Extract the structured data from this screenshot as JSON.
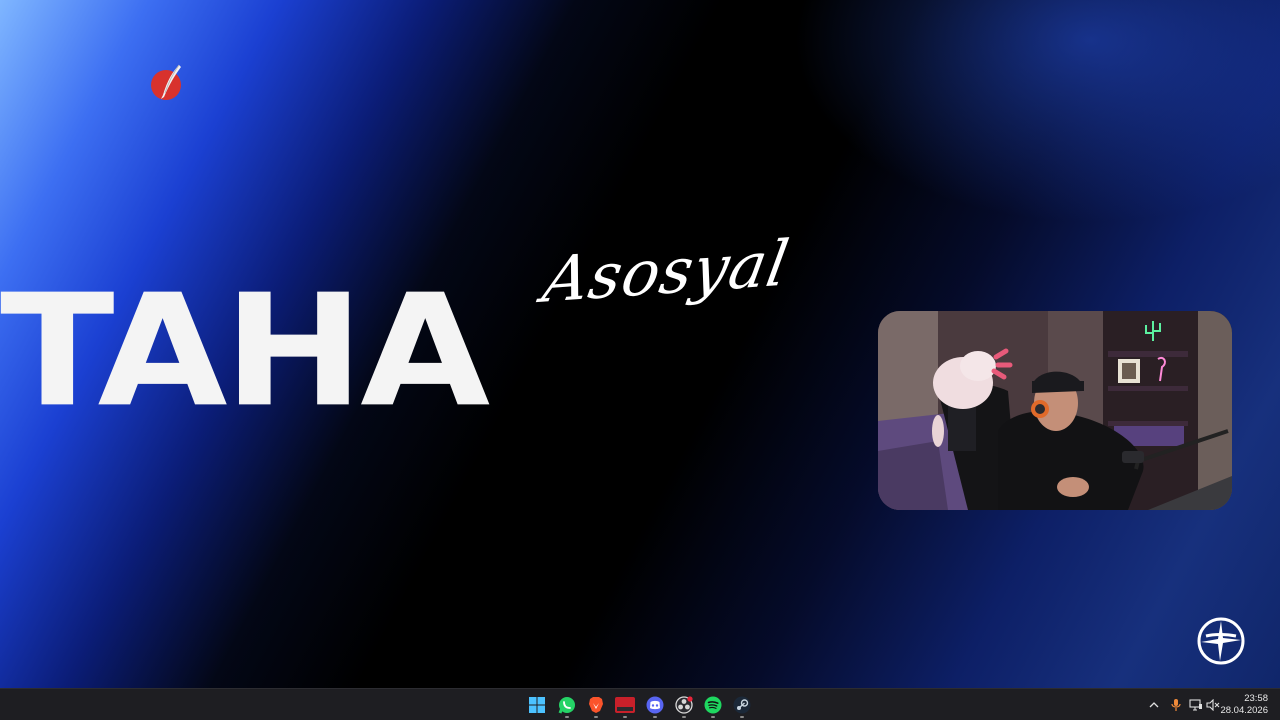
{
  "wallpaper": {
    "script_word": "Asosyal",
    "main_word": "TAHA",
    "accent_colors": [
      "#1b40d2",
      "#7fb6ff",
      "#000000"
    ]
  },
  "desktop": {
    "app_icon": "red-quill-app-icon",
    "corner_logo": "white-cross-circle-logo-icon"
  },
  "webcam": {
    "description_icon": "webcam-feed"
  },
  "taskbar": {
    "apps": [
      {
        "name": "Start",
        "icon": "windows-start-icon"
      },
      {
        "name": "WhatsApp",
        "icon": "whatsapp-icon"
      },
      {
        "name": "Brave",
        "icon": "brave-browser-icon"
      },
      {
        "name": "Voice Settings",
        "icon": "voice-settings-app-icon",
        "badge_text": "VOICE"
      },
      {
        "name": "Discord",
        "icon": "discord-icon"
      },
      {
        "name": "OBS",
        "icon": "obs-icon"
      },
      {
        "name": "Spotify",
        "icon": "spotify-icon"
      },
      {
        "name": "Steam",
        "icon": "steam-icon"
      }
    ],
    "tray": {
      "icons": [
        "chevron-up-icon",
        "microphone-icon",
        "display-icon",
        "volume-muted-icon"
      ]
    },
    "clock": {
      "time": "23:58",
      "date": "28.04.2026"
    }
  }
}
